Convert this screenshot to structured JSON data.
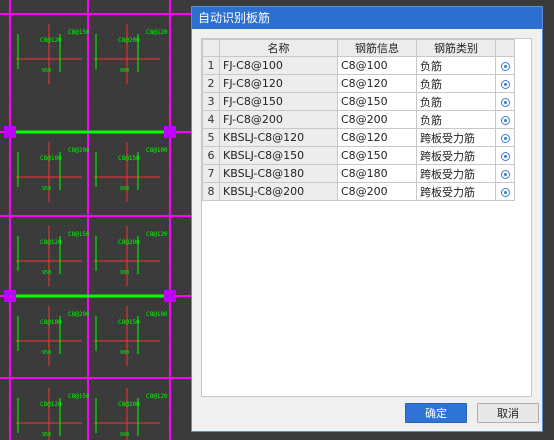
{
  "dialog": {
    "title": "自动识别板筋",
    "columns": {
      "name": "名称",
      "info": "钢筋信息",
      "type": "钢筋类别"
    },
    "rows": [
      {
        "num": "1",
        "name": "FJ-C8@100",
        "info": "C8@100",
        "type": "负筋"
      },
      {
        "num": "2",
        "name": "FJ-C8@120",
        "info": "C8@120",
        "type": "负筋"
      },
      {
        "num": "3",
        "name": "FJ-C8@150",
        "info": "C8@150",
        "type": "负筋"
      },
      {
        "num": "4",
        "name": "FJ-C8@200",
        "info": "C8@200",
        "type": "负筋"
      },
      {
        "num": "5",
        "name": "KBSLJ-C8@120",
        "info": "C8@120",
        "type": "跨板受力筋"
      },
      {
        "num": "6",
        "name": "KBSLJ-C8@150",
        "info": "C8@150",
        "type": "跨板受力筋"
      },
      {
        "num": "7",
        "name": "KBSLJ-C8@180",
        "info": "C8@180",
        "type": "跨板受力筋"
      },
      {
        "num": "8",
        "name": "KBSLJ-C8@200",
        "info": "C8@200",
        "type": "跨板受力筋"
      }
    ],
    "ok_label": "确定",
    "cancel_label": "取消"
  },
  "cad": {
    "labels": [
      "C8@150",
      "C8@120",
      "C8@200",
      "C8@100",
      "950",
      "900"
    ],
    "colors": {
      "background": "#3a3a3a",
      "beam": "#ff00ff",
      "rebar": "#00ff00",
      "dim": "#ff3030"
    }
  }
}
